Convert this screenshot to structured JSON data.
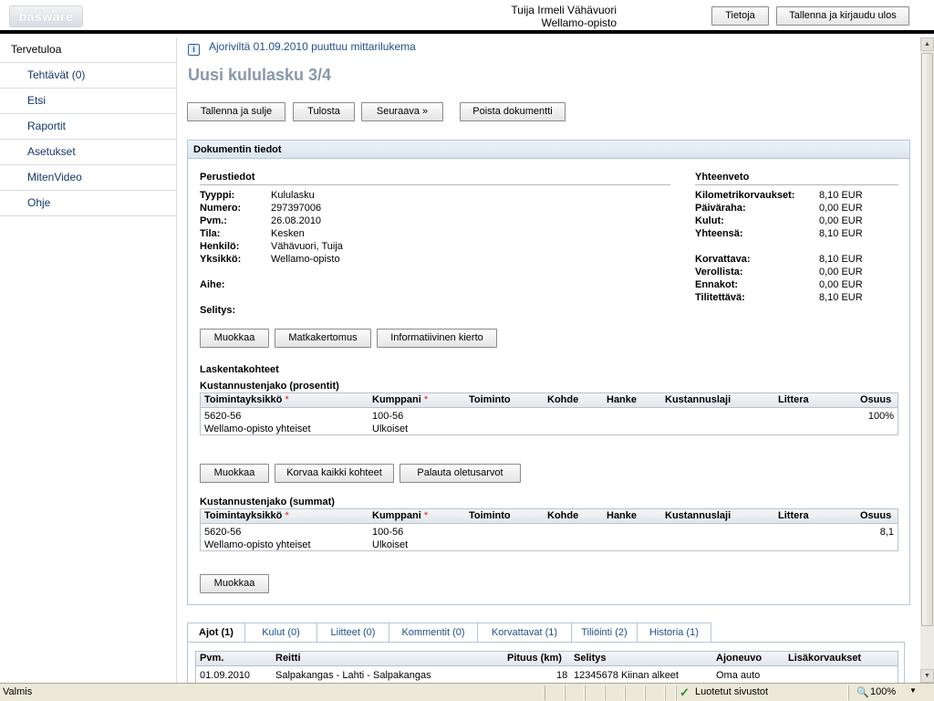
{
  "header": {
    "logo_text": "basware",
    "user_name": "Tuija Irmeli Vähävuori",
    "organization": "Wellamo-opisto",
    "about_label": "Tietoja",
    "save_logout_label": "Tallenna ja kirjaudu ulos"
  },
  "sidebar": {
    "home": "Tervetuloa",
    "tasks_label": "Tehtävät",
    "tasks_count": "(0)",
    "items": [
      "Etsi",
      "Raportit",
      "Asetukset",
      "MitenVideo",
      "Ohje"
    ]
  },
  "notice": "Ajoriviltä 01.09.2010 puuttuu mittarilukema",
  "page_title": "Uusi kululasku 3/4",
  "toolbar": {
    "save_close": "Tallenna ja sulje",
    "print": "Tulosta",
    "next": "Seuraava »",
    "delete": "Poista dokumentti"
  },
  "doc_panel": {
    "title": "Dokumentin tiedot",
    "basic_title": "Perustiedot",
    "basic": [
      {
        "label": "Tyyppi:",
        "value": "Kululasku"
      },
      {
        "label": "Numero:",
        "value": "297397006"
      },
      {
        "label": "Pvm.:",
        "value": "26.08.2010"
      },
      {
        "label": "Tila:",
        "value": "Kesken"
      },
      {
        "label": "Henkilö:",
        "value": "Vähävuori, Tuija"
      },
      {
        "label": "Yksikkö:",
        "value": "Wellamo-opisto"
      }
    ],
    "subject_label": "Aihe:",
    "explanation_label": "Selitys:",
    "summary_title": "Yhteenveto",
    "summary": [
      {
        "label": "Kilometrikorvaukset:",
        "value": "8,10 EUR"
      },
      {
        "label": "Päiväraha:",
        "value": "0,00 EUR"
      },
      {
        "label": "Kulut:",
        "value": "0,00 EUR"
      },
      {
        "label": "Yhteensä:",
        "value": "8,10 EUR"
      }
    ],
    "summary2": [
      {
        "label": "Korvattava:",
        "value": "8,10 EUR"
      },
      {
        "label": "Verollista:",
        "value": "0,00 EUR"
      },
      {
        "label": "Ennakot:",
        "value": "0,00 EUR"
      },
      {
        "label": "Tilitettävä:",
        "value": "8,10 EUR"
      }
    ],
    "edit_label": "Muokkaa",
    "travel_report_label": "Matkakertomus",
    "info_circulation_label": "Informatiivinen kierto",
    "cost_objects_title": "Laskentakohteet",
    "percent_title": "Kustannustenjako (prosentit)",
    "sum_title": "Kustannustenjako (summat)",
    "replace_all_label": "Korvaa kaikki kohteet",
    "restore_defaults_label": "Palauta oletusarvot",
    "columns": [
      "Toimintayksikkö",
      "Kumppani",
      "Toiminto",
      "Kohde",
      "Hanke",
      "Kustannuslaji",
      "Littera",
      "Osuus"
    ],
    "required_mark": "*",
    "percent_row": {
      "unit": "5620-56",
      "unit_name": "Wellamo-opisto yhteiset",
      "partner": "100-56",
      "partner_name": "Ulkoiset",
      "share": "100%"
    },
    "sum_row": {
      "unit": "5620-56",
      "unit_name": "Wellamo-opisto yhteiset",
      "partner": "100-56",
      "partner_name": "Ulkoiset",
      "share": "8,1"
    }
  },
  "tabs": [
    "Ajot (1)",
    "Kulut (0)",
    "Liitteet (0)",
    "Kommentit (0)",
    "Korvattavat (1)",
    "Tiliöinti (2)",
    "Historia (1)"
  ],
  "trips": {
    "columns": [
      "Pvm.",
      "Reitti",
      "Pituus (km)",
      "Selitys",
      "Ajoneuvo",
      "Lisäkorvaukset"
    ],
    "rows": [
      {
        "date": "01.09.2010",
        "route": "Salpakangas - Lahti - Salpakangas",
        "length": "18",
        "explanation": "12345678 Kiinan alkeet",
        "vehicle": "Oma auto",
        "extra": ""
      }
    ]
  },
  "statusbar": {
    "status": "Valmis",
    "zone": "Luotetut sivustot",
    "zoom": "100%"
  }
}
